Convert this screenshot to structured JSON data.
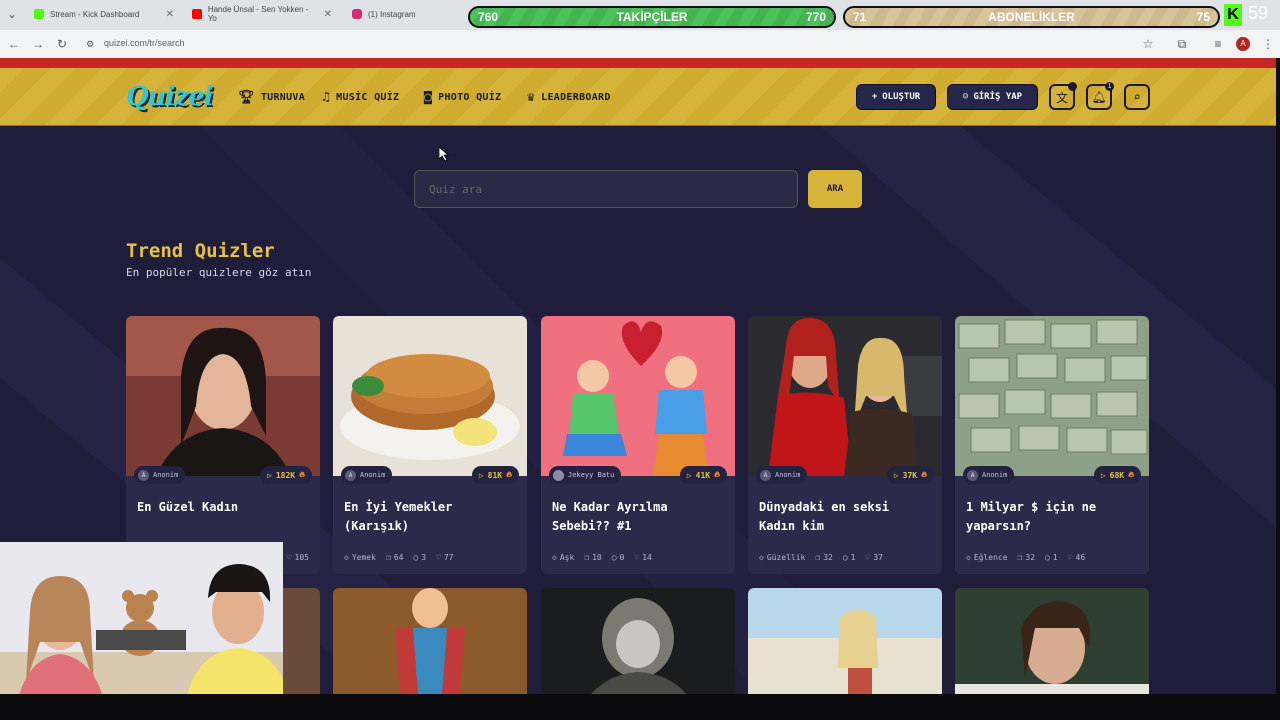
{
  "browser": {
    "tabs": [
      {
        "title": "Stream - Kick Dashboard",
        "color": "#53fc18"
      },
      {
        "title": "Hande Ünsal - Sen Yokken - Yo",
        "color": "#ff0000"
      },
      {
        "title": "(1) Instagram",
        "color": "#d62976"
      }
    ],
    "url": "quizei.com/tr/search",
    "profile_initial": "A"
  },
  "overlay": {
    "followers": {
      "current": "760",
      "label": "TAKİPÇİLER",
      "goal": "770"
    },
    "subs": {
      "current": "71",
      "label": "ABONELİKLER",
      "goal": "75"
    },
    "kick_logo": "K",
    "kick_count": "59"
  },
  "site": {
    "logo": "Quizei",
    "nav": [
      {
        "label": "TURNUVA",
        "icon": "trophy-icon"
      },
      {
        "label": "MUSİC QUİZ",
        "icon": "music-icon"
      },
      {
        "label": "PHOTO QUİZ",
        "icon": "camera-icon"
      },
      {
        "label": "LEADERBOARD",
        "icon": "award-icon"
      }
    ],
    "create_label": "OLUŞTUR",
    "login_label": "GİRİŞ YAP",
    "notif_count": "1",
    "search_placeholder": "Quiz ara",
    "search_button": "ARA",
    "section_title": "Trend Quizler",
    "section_subtitle": "En popüler quizlere göz atın",
    "cards": [
      {
        "author": "Anonim",
        "plays": "182K",
        "title": "En Güzel Kadın",
        "category": "",
        "questions": "",
        "comments": "",
        "likes": "105"
      },
      {
        "author": "Anonim",
        "plays": "81K",
        "title": "En İyi Yemekler (Karışık)",
        "category": "Yemek",
        "questions": "64",
        "comments": "3",
        "likes": "77"
      },
      {
        "author": "Jekeyy Batu",
        "plays": "41K",
        "title": "Ne Kadar Ayrılma Sebebi?? #1",
        "category": "Aşk",
        "questions": "10",
        "comments": "0",
        "likes": "14"
      },
      {
        "author": "Anonim",
        "plays": "37K",
        "title": "Dünyadaki en seksi Kadın kim",
        "category": "Güzellik",
        "questions": "32",
        "comments": "1",
        "likes": "37"
      },
      {
        "author": "Anonim",
        "plays": "68K",
        "title": "1 Milyar $ için ne yaparsın?",
        "category": "Eğlence",
        "questions": "32",
        "comments": "1",
        "likes": "46"
      }
    ]
  }
}
